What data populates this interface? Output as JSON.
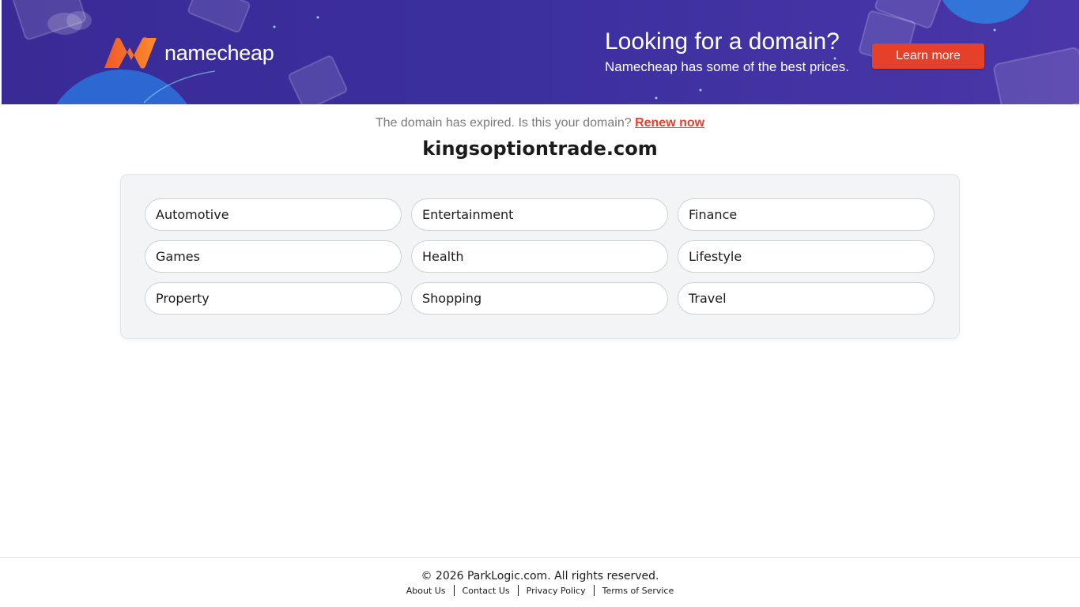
{
  "banner": {
    "brand_name": "namecheap",
    "promo_title": "Looking for a domain?",
    "promo_subtitle": "Namecheap has some of the best prices.",
    "cta_label": "Learn more",
    "colors": {
      "background": "#3b2f9e",
      "cta": "#e5412a",
      "logo_gradient_start": "#f05a28",
      "logo_gradient_end": "#fd8a2b"
    }
  },
  "notice": {
    "text": "The domain has expired. Is this your domain?",
    "renew_link": "Renew now"
  },
  "domain": "kingsoptiontrade.com",
  "categories": [
    "Automotive",
    "Entertainment",
    "Finance",
    "Games",
    "Health",
    "Lifestyle",
    "Property",
    "Shopping",
    "Travel"
  ],
  "footer": {
    "copyright": "© 2026 ParkLogic.com. All rights reserved.",
    "links": [
      "About Us",
      "Contact Us",
      "Privacy Policy",
      "Terms of Service"
    ]
  }
}
